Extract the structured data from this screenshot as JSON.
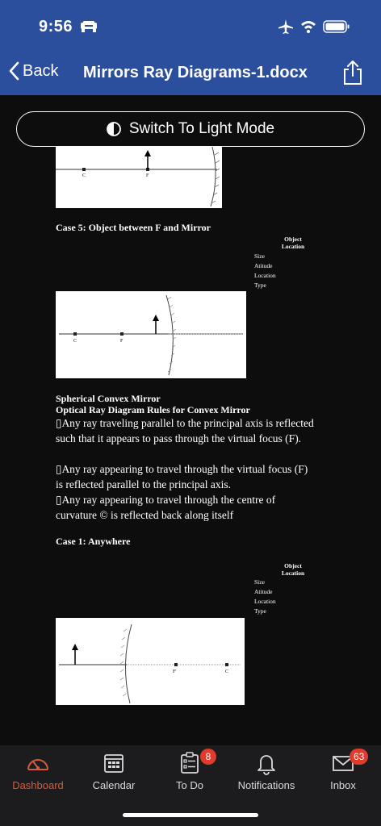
{
  "status": {
    "time": "9:56"
  },
  "nav": {
    "back_label": "Back",
    "title": "Mirrors Ray Diagrams-1.docx"
  },
  "content": {
    "switch_label": "Switch To Light Mode",
    "case5": {
      "title": "Case 5: Object between F and Mirror",
      "col_header": "Object\nLocation",
      "rows": [
        "Size",
        "Atitude",
        "Location",
        "Type"
      ],
      "labels": {
        "c": "C",
        "f": "F"
      }
    },
    "convex": {
      "heading1": "Spherical Convex Mirror",
      "heading2": "Optical Ray Diagram Rules for Convex Mirror",
      "rule1": "Any ray traveling parallel to the principal axis is reflected such that it appears to pass through the virtual focus (F).",
      "rule2": "Any ray appearing to travel through the virtual focus (F) is reflected parallel to the principal axis.",
      "rule3": "Any ray appearing to travel through the centre of curvature © is reflected back along itself",
      "bullet": "▯"
    },
    "case1": {
      "title": "Case 1:  Anywhere",
      "col_header": "Object\nLocation",
      "rows": [
        "Size",
        "Atitude",
        "Location",
        "Type"
      ],
      "labels": {
        "f": "F'",
        "c": "C"
      }
    },
    "top_diagram_labels": {
      "c": "C",
      "f": "F"
    }
  },
  "tabs": [
    {
      "label": "Dashboard",
      "icon": "gauge-icon",
      "active": true
    },
    {
      "label": "Calendar",
      "icon": "calendar-icon"
    },
    {
      "label": "To Do",
      "icon": "todo-icon",
      "badge": "8"
    },
    {
      "label": "Notifications",
      "icon": "bell-icon"
    },
    {
      "label": "Inbox",
      "icon": "mail-icon",
      "badge": "63"
    }
  ],
  "colors": {
    "header_bg": "#2b4f9c",
    "active_tab": "#d65b3c",
    "badge": "#e13b2d"
  }
}
